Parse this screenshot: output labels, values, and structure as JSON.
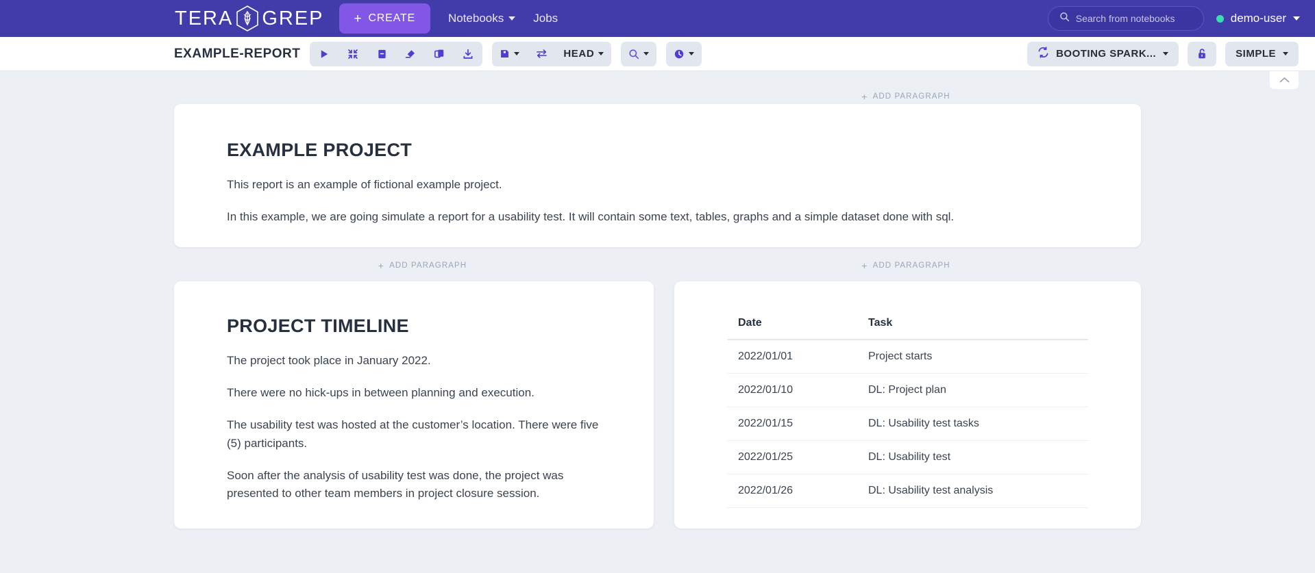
{
  "topnav": {
    "brand": "TERA",
    "brand2": "GREP",
    "brand_logo_icon": "teragrep-leaf-logo-icon",
    "create_label": "CREATE",
    "create_plus": "+",
    "links": [
      {
        "label": "Notebooks",
        "has_caret": true
      },
      {
        "label": "Jobs",
        "has_caret": false
      }
    ],
    "search": {
      "icon": "search-icon",
      "placeholder": "Search from notebooks",
      "value": ""
    },
    "user": {
      "name": "demo-user",
      "status_dot_color": "#3ddbb0",
      "status_dot_icon": "online-status-dot-icon"
    }
  },
  "toolbar": {
    "notebook_title": "EXAMPLE-REPORT",
    "group1": [
      {
        "name": "run-all-button",
        "icon": "play-icon"
      },
      {
        "name": "collapse-all-button",
        "icon": "minimize-arrows-icon"
      },
      {
        "name": "show-code-button",
        "icon": "note-list-icon"
      },
      {
        "name": "clear-output-button",
        "icon": "eraser-icon"
      },
      {
        "name": "clone-notebook-button",
        "icon": "copy-icon"
      },
      {
        "name": "export-notebook-button",
        "icon": "download-icon"
      }
    ],
    "group2": {
      "save_icon": "floppy-save-icon",
      "save_caret": true,
      "sync_icon": "swap-arrows-icon",
      "branch_label": "HEAD",
      "branch_caret": true
    },
    "group3": {
      "icon": "search-icon",
      "caret": true
    },
    "group4": {
      "icon": "clock-icon",
      "caret": true
    },
    "spark": {
      "icon": "refresh-sync-icon",
      "label": "BOOTING SPARK...",
      "caret": true
    },
    "permission": {
      "icon": "unlocked-padlock-icon"
    },
    "mode": {
      "label": "SIMPLE",
      "caret": true
    }
  },
  "workspace": {
    "collapse_tab_icon": "chevron-up-icon",
    "add_paragraph_label": "ADD PARAGRAPH",
    "add_paragraph_plus": "+"
  },
  "paragraphs": {
    "intro": {
      "title": "EXAMPLE PROJECT",
      "p1": "This report is an example of fictional example project.",
      "p2": "In this example, we are going simulate a report for a usability test. It will contain some text, tables, graphs and a simple dataset done with sql."
    },
    "timeline": {
      "title": "PROJECT TIMELINE",
      "p1": "The project took place in January 2022.",
      "p2": "There were no hick-ups in between planning and execution.",
      "p3": "The usability test was hosted at the customer’s location. There were five (5) participants.",
      "p4": "Soon after the analysis of usability test was done, the project was presented to other team members in project closure session."
    },
    "table": {
      "columns": [
        "Date",
        "Task"
      ],
      "rows": [
        [
          "2022/01/01",
          "Project starts"
        ],
        [
          "2022/01/10",
          "DL: Project plan"
        ],
        [
          "2022/01/15",
          "DL: Usability test tasks"
        ],
        [
          "2022/01/25",
          "DL: Usability test"
        ],
        [
          "2022/01/26",
          "DL: Usability test analysis"
        ]
      ]
    }
  },
  "colors": {
    "nav_bg": "#413caa",
    "create_btn": "#8257e6",
    "icon_purple": "#4a3fd0",
    "page_bg": "#eceff4",
    "accent_green": "#3ddbb0"
  }
}
